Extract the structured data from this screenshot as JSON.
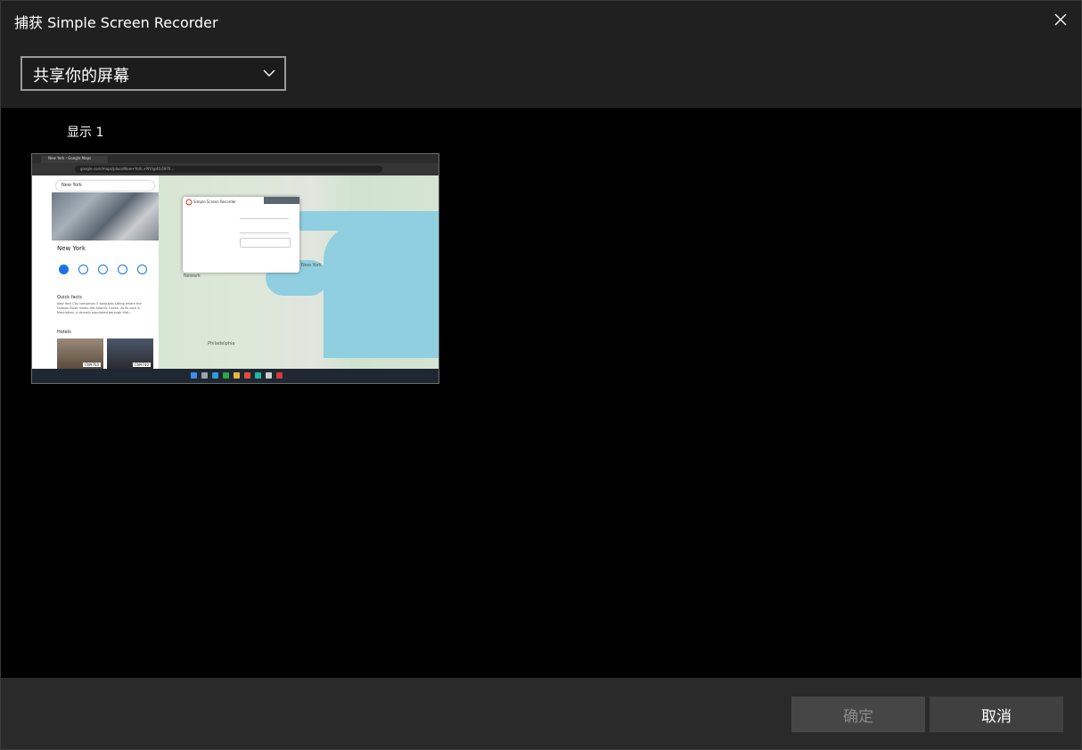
{
  "window": {
    "title": "捕获 Simple Screen Recorder"
  },
  "source_select": {
    "selected": "共享你的屏幕"
  },
  "content": {
    "display_label": "显示 1",
    "thumbnail": {
      "tab_title": "New York - Google Maps",
      "address": "google.com/maps/place/New+York,+NY/@40.6970...",
      "search_text": "New York",
      "place_name": "New York",
      "quick_facts_heading": "Quick facts",
      "quick_facts_text": "New York City comprises 5 boroughs sitting where the Hudson River meets the Atlantic Ocean. At its core is Manhattan, a densely populated borough that...",
      "hotels_heading": "Hotels",
      "hotel_prices": [
        "CN¥760",
        "CN¥740"
      ],
      "dialog_title": "Simple Screen Recorder",
      "map_labels": [
        "New York",
        "Newark",
        "Philadelphia"
      ]
    }
  },
  "footer": {
    "ok_label": "确定",
    "cancel_label": "取消"
  },
  "colors": {
    "window_bg": "#202020",
    "content_bg": "#000000",
    "footer_bg": "#2a2a2a",
    "ok_disabled_bg": "#464646",
    "ok_disabled_text": "#8b8b8b",
    "cancel_bg": "#404040",
    "select_border": "#9a9a9a"
  },
  "icons": {
    "close": "close-icon",
    "dropdown": "chevron-down-icon"
  }
}
